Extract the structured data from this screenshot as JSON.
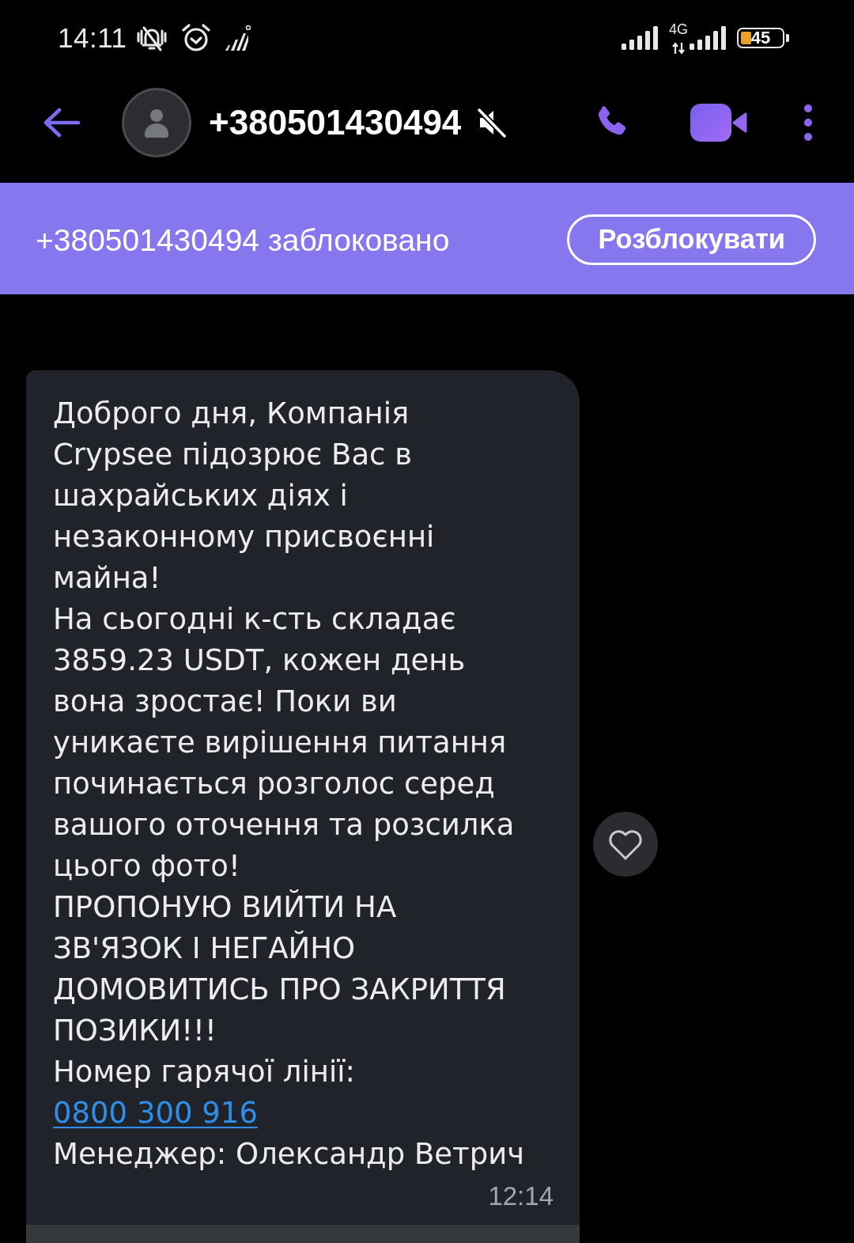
{
  "status_bar": {
    "time": "14:11",
    "network_type": "4G",
    "battery": "45"
  },
  "header": {
    "contact": "+380501430494",
    "muted": true
  },
  "blocked_banner": {
    "text": "+380501430494 заблоковано",
    "button": "Розблокувати"
  },
  "messages": [
    {
      "kind": "incoming",
      "paragraphs": [
        {
          "text": "Доброго дня, Компанія Crypsee підозрює Вас в шахрайських діях і незаконному присвоєнні майна!"
        },
        {
          "text": "На сьогодні к-сть складає 3859.23 USDT, кожен день вона зростає! Поки ви уникаєте вирішення питання починається розголос серед вашого оточення та розсилка цього фото!"
        },
        {
          "text": "ПРОПОНУЮ ВИЙТИ НА ЗВ'ЯЗОК І НЕГАЙНО ДОМОВИТИСЬ ПРО ЗАКРИТТЯ ПОЗИКИ!!!"
        },
        {
          "text": "Номер гарячої лінії:",
          "link": "0800 300 916"
        },
        {
          "text": "Менеджер: Олександр Ветрич"
        }
      ],
      "time": "12:14",
      "liked": false
    }
  ]
}
